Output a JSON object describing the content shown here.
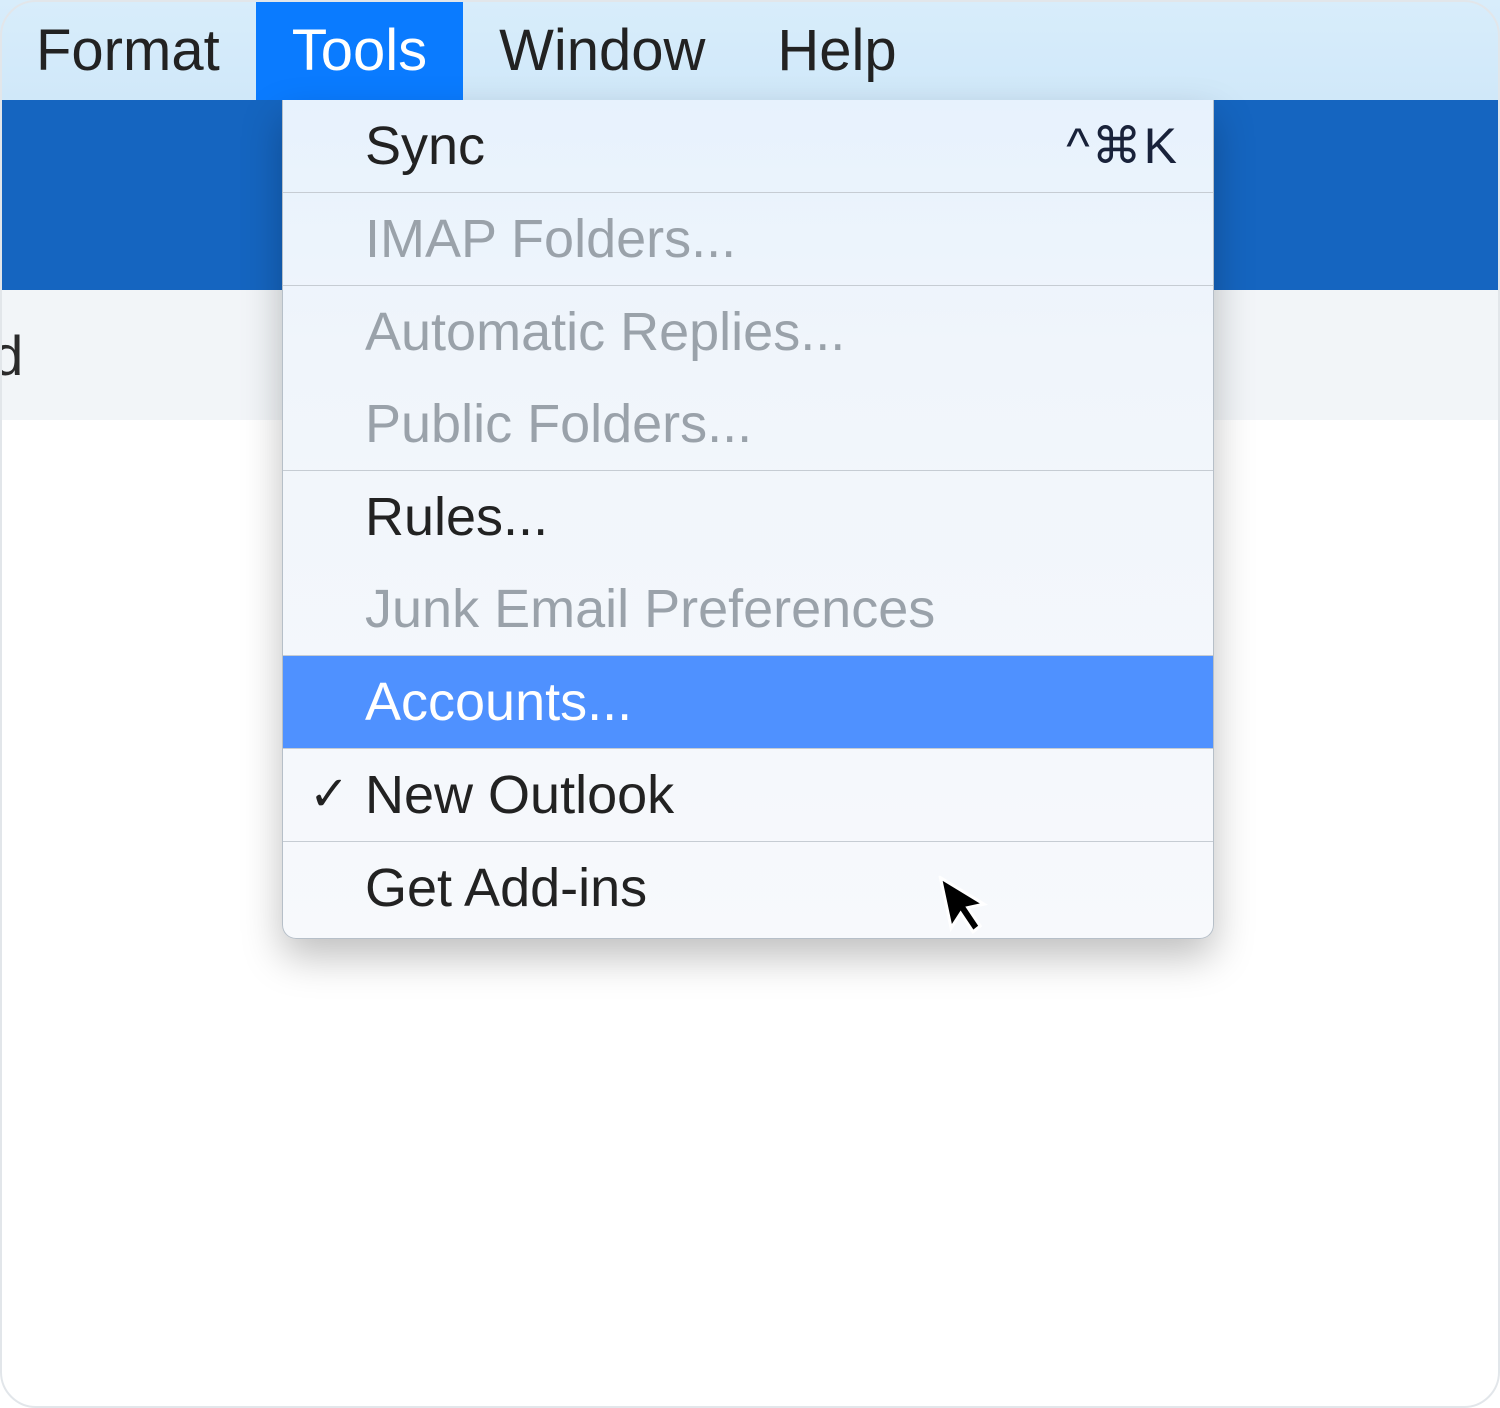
{
  "menubar": {
    "items": [
      {
        "label": "Format",
        "active": false
      },
      {
        "label": "Tools",
        "active": true
      },
      {
        "label": "Window",
        "active": false
      },
      {
        "label": "Help",
        "active": false
      }
    ]
  },
  "toolbar": {
    "partial_label": "nread"
  },
  "dropdown": {
    "groups": [
      {
        "items": [
          {
            "label": "Sync",
            "shortcut": "^⌘K",
            "disabled": false,
            "highlight": false,
            "checked": false
          }
        ]
      },
      {
        "items": [
          {
            "label": "IMAP Folders...",
            "shortcut": "",
            "disabled": true,
            "highlight": false,
            "checked": false
          }
        ]
      },
      {
        "items": [
          {
            "label": "Automatic Replies...",
            "shortcut": "",
            "disabled": true,
            "highlight": false,
            "checked": false
          },
          {
            "label": "Public Folders...",
            "shortcut": "",
            "disabled": true,
            "highlight": false,
            "checked": false
          }
        ]
      },
      {
        "items": [
          {
            "label": "Rules...",
            "shortcut": "",
            "disabled": false,
            "highlight": false,
            "checked": false
          },
          {
            "label": "Junk Email Preferences",
            "shortcut": "",
            "disabled": true,
            "highlight": false,
            "checked": false
          }
        ]
      },
      {
        "items": [
          {
            "label": "Accounts...",
            "shortcut": "",
            "disabled": false,
            "highlight": true,
            "checked": false
          }
        ]
      },
      {
        "items": [
          {
            "label": "New Outlook",
            "shortcut": "",
            "disabled": false,
            "highlight": false,
            "checked": true
          }
        ]
      },
      {
        "items": [
          {
            "label": "Get Add-ins",
            "shortcut": "",
            "disabled": false,
            "highlight": false,
            "checked": false
          }
        ]
      }
    ]
  },
  "checkmark_glyph": "✓"
}
